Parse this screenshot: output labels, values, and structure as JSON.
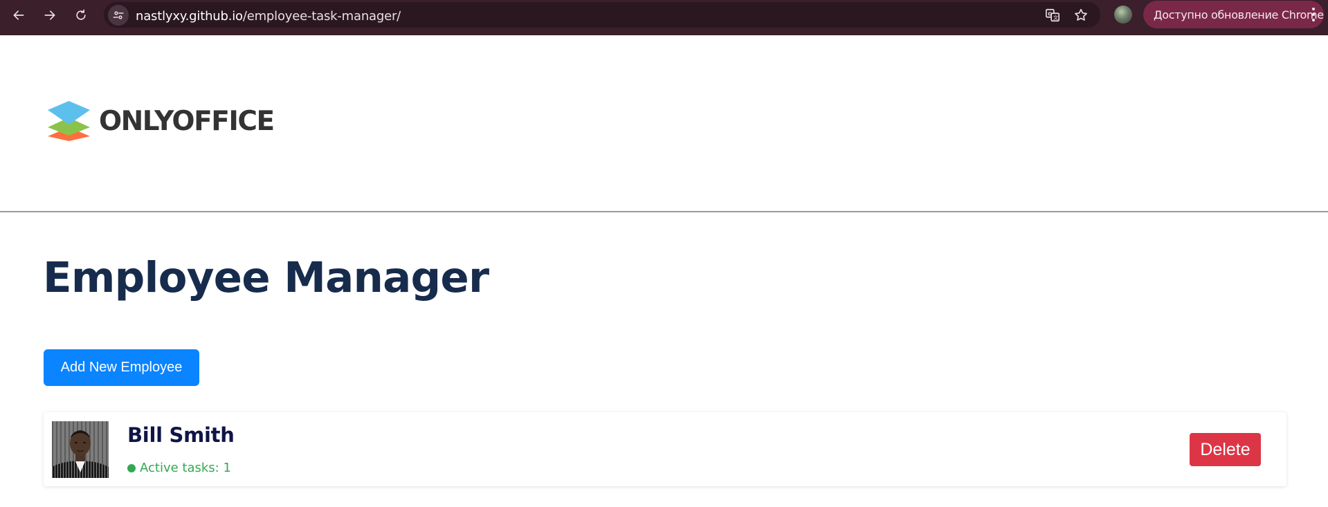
{
  "browser": {
    "url_host": "nastlyxy.github.io",
    "url_path": "/employee-task-manager/",
    "update_button_label": "Доступно обновление Chrome",
    "icons": [
      "back-arrow-icon",
      "forward-arrow-icon",
      "reload-icon",
      "site-info-icon",
      "translate-icon",
      "bookmark-star-icon",
      "profile-avatar",
      "more-menu-icon"
    ]
  },
  "header": {
    "logo_text": "ONLYOFFICE",
    "logo_colors": [
      "#5dc0ec",
      "#8bc34a",
      "#ff6f3d"
    ]
  },
  "main": {
    "title": "Employee Manager",
    "add_button_label": "Add New Employee",
    "employees": [
      {
        "name": "Bill Smith",
        "status_text": "Active tasks: 1",
        "status_color": "#32a852",
        "delete_label": "Delete"
      }
    ]
  },
  "colors": {
    "accent": "#0a84ff",
    "danger": "#dc3545",
    "title": "#172b4d",
    "chrome_bg": "#3b1f2b"
  }
}
